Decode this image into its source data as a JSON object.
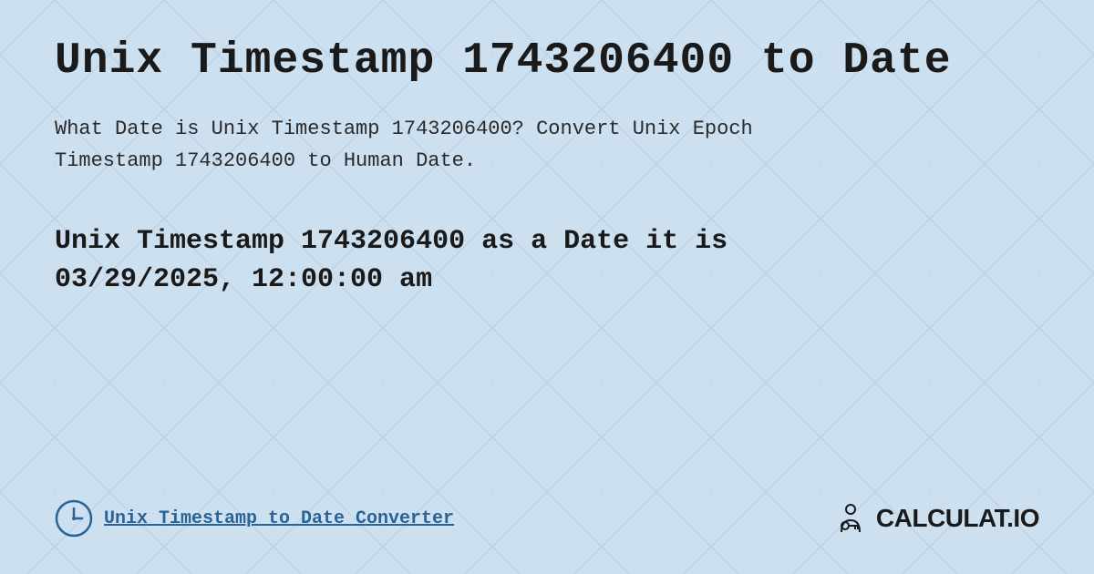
{
  "page": {
    "title": "Unix Timestamp 1743206400 to Date",
    "description_part1": "What Date is Unix Timestamp 1743206400? Convert Unix Epoch",
    "description_part2": "Timestamp 1743206400 to Human Date.",
    "result_line1": "Unix Timestamp 1743206400 as a Date it is",
    "result_line2": "03/29/2025, 12:00:00 am",
    "footer_link": "Unix Timestamp to Date Converter",
    "brand": "CALCULAT.IO",
    "background_color": "#cde0f0",
    "title_color": "#1a1a1a",
    "link_color": "#2a6496"
  }
}
